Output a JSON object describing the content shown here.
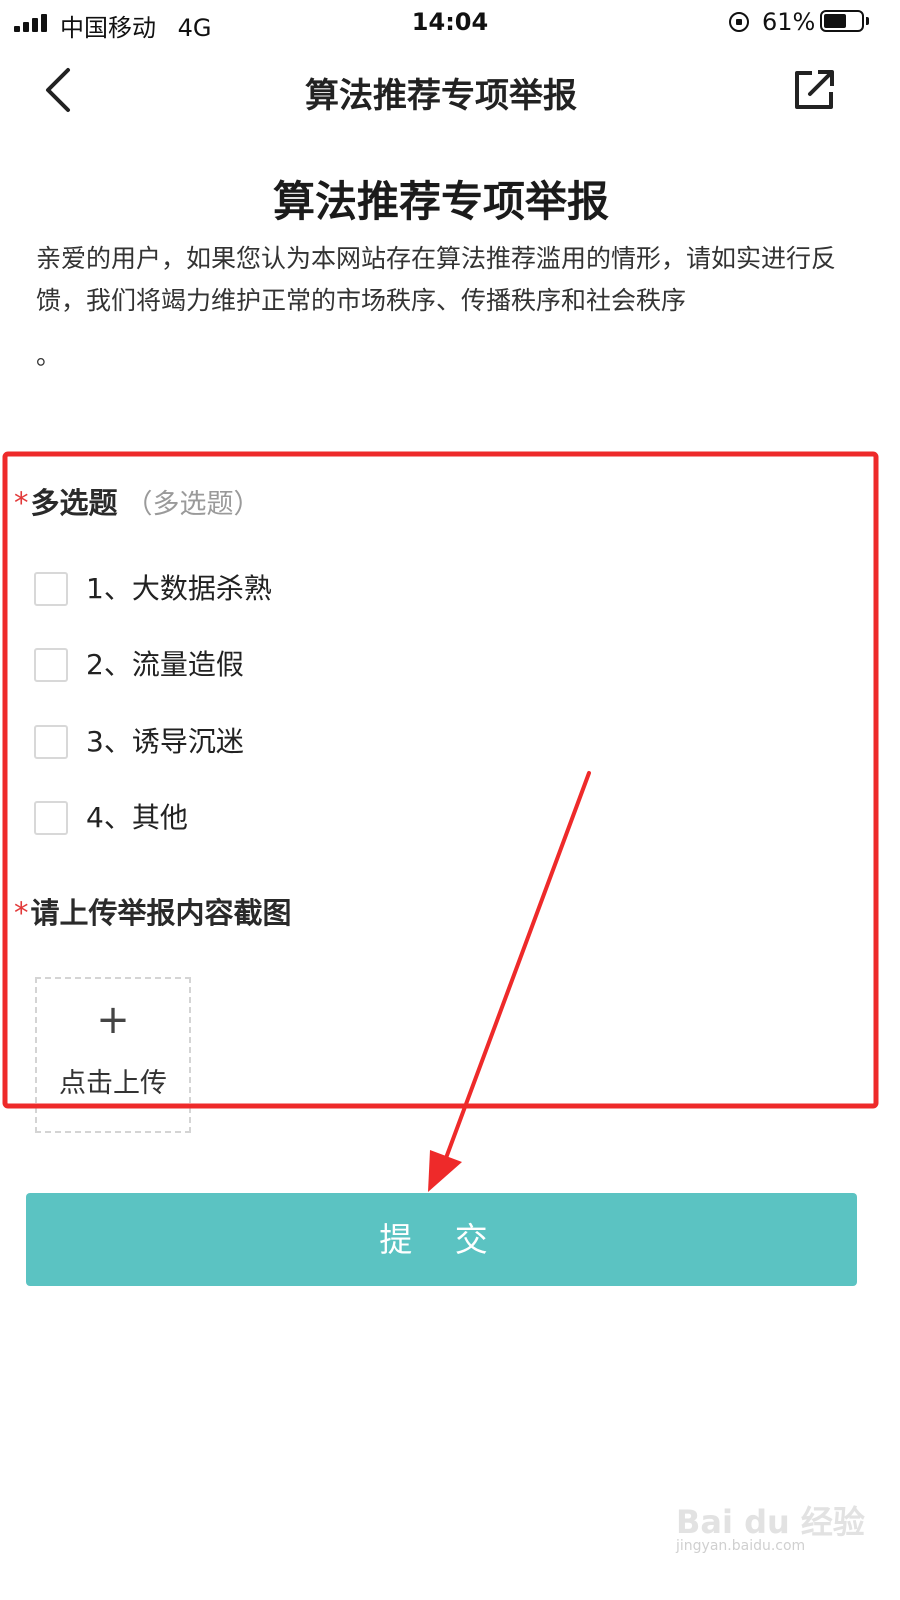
{
  "status_bar": {
    "carrier": "中国移动",
    "network": "4G",
    "time": "14:04",
    "battery": "61%",
    "battery_level": 0.61
  },
  "nav": {
    "title": "算法推荐专项举报",
    "back_icon": "chevron-left-icon",
    "share_icon": "share-icon"
  },
  "page": {
    "heading": "算法推荐专项举报",
    "intro": "亲爱的用户，如果您认为本网站存在算法推荐滥用的情形，请如实进行反馈，我们将竭力维护正常的市场秩序、传播秩序和社会秩序",
    "intro_tail": "。"
  },
  "question1": {
    "required_mark": "*",
    "title": "多选题",
    "subtitle": "（多选题）",
    "options": [
      {
        "label": "1、大数据杀熟",
        "checked": false
      },
      {
        "label": "2、流量造假",
        "checked": false
      },
      {
        "label": "3、诱导沉迷",
        "checked": false
      },
      {
        "label": "4、其他",
        "checked": false
      }
    ]
  },
  "question2": {
    "required_mark": "*",
    "title": "请上传举报内容截图",
    "upload_plus": "+",
    "upload_label": "点击上传"
  },
  "submit_label": "提 交",
  "colors": {
    "accent": "#5bc3c2",
    "required": "#e23a3a",
    "annotation": "#ee2a2a"
  },
  "watermark": {
    "text": "Bai du 经验",
    "sub": "jingyan.baidu.com"
  }
}
